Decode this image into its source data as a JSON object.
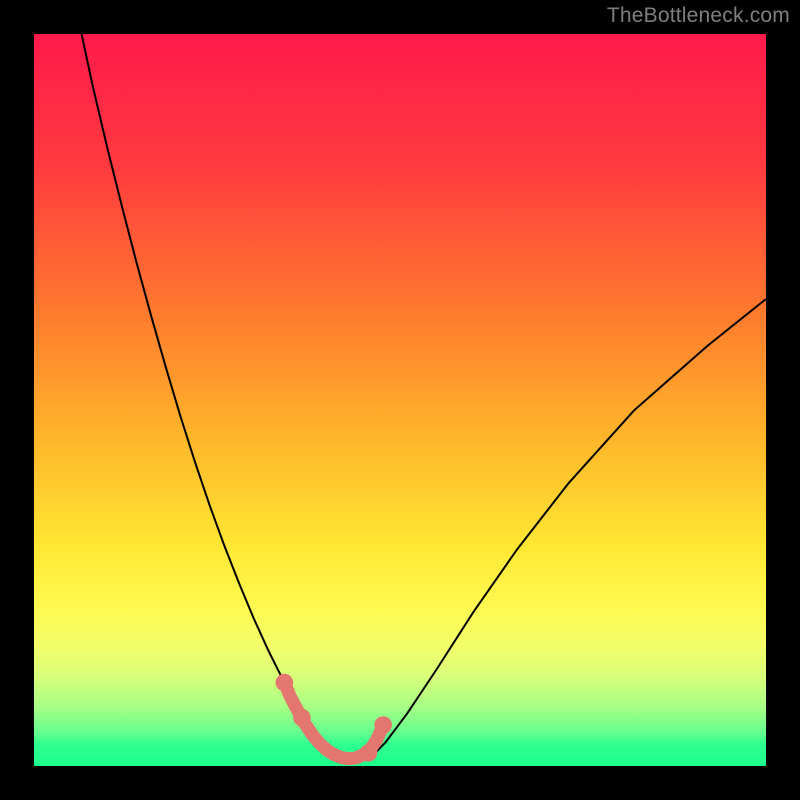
{
  "watermark": "TheBottleneck.com",
  "chart_data": {
    "type": "line",
    "title": "",
    "xlabel": "",
    "ylabel": "",
    "xlim": [
      0,
      100
    ],
    "ylim": [
      0,
      100
    ],
    "gradient_stops": [
      {
        "offset": 0,
        "color": "#ff1a4b"
      },
      {
        "offset": 18,
        "color": "#ff3a3f"
      },
      {
        "offset": 38,
        "color": "#ff7a2e"
      },
      {
        "offset": 55,
        "color": "#ffb52a"
      },
      {
        "offset": 70,
        "color": "#ffe733"
      },
      {
        "offset": 78,
        "color": "#fff94f"
      },
      {
        "offset": 84,
        "color": "#f1ff6b"
      },
      {
        "offset": 88,
        "color": "#d6ff7a"
      },
      {
        "offset": 92,
        "color": "#a6ff85"
      },
      {
        "offset": 95.5,
        "color": "#63ff8e"
      },
      {
        "offset": 97,
        "color": "#2fff8f"
      },
      {
        "offset": 100,
        "color": "#1cff8d"
      }
    ],
    "series": [
      {
        "name": "bottleneck-curve",
        "stroke": "#000000",
        "stroke_width": 2,
        "x": [
          6.5,
          8,
          10,
          12,
          14,
          16,
          18,
          20,
          22,
          24,
          26,
          28,
          30,
          32,
          33.5,
          35,
          36.5,
          38,
          40,
          42,
          44,
          46,
          48,
          51,
          55,
          60,
          66,
          73,
          82,
          92,
          100
        ],
        "y": [
          100,
          93,
          84.5,
          76.5,
          68.8,
          61.5,
          54.5,
          47.8,
          41.5,
          35.6,
          30.1,
          25,
          20.2,
          15.8,
          12.8,
          10,
          7.4,
          5.2,
          2.7,
          1.3,
          0.8,
          1.2,
          3.2,
          7.2,
          13.2,
          21,
          29.6,
          38.6,
          48.6,
          57.4,
          63.8
        ]
      },
      {
        "name": "marker-curve",
        "stroke": "#e3766e",
        "stroke_width": 13,
        "linecap": "round",
        "x": [
          34.2,
          35,
          36,
          37,
          38,
          39,
          40,
          41,
          42,
          43,
          44,
          45,
          46,
          46.8,
          47.6
        ],
        "y": [
          11.4,
          9.5,
          7.6,
          5.8,
          4.3,
          3.1,
          2.2,
          1.55,
          1.15,
          1.0,
          1.1,
          1.55,
          2.35,
          3.55,
          5.3
        ]
      }
    ],
    "markers": [
      {
        "name": "dot-left-upper",
        "x": 34.2,
        "y": 11.4,
        "r": 8.8,
        "fill": "#e3766e"
      },
      {
        "name": "dot-left-lower",
        "x": 36.6,
        "y": 6.6,
        "r": 8.8,
        "fill": "#e3766e"
      },
      {
        "name": "dot-right-lower",
        "x": 45.7,
        "y": 1.8,
        "r": 8.8,
        "fill": "#e3766e"
      },
      {
        "name": "dot-right-upper",
        "x": 47.7,
        "y": 5.6,
        "r": 8.8,
        "fill": "#e3766e"
      }
    ]
  }
}
